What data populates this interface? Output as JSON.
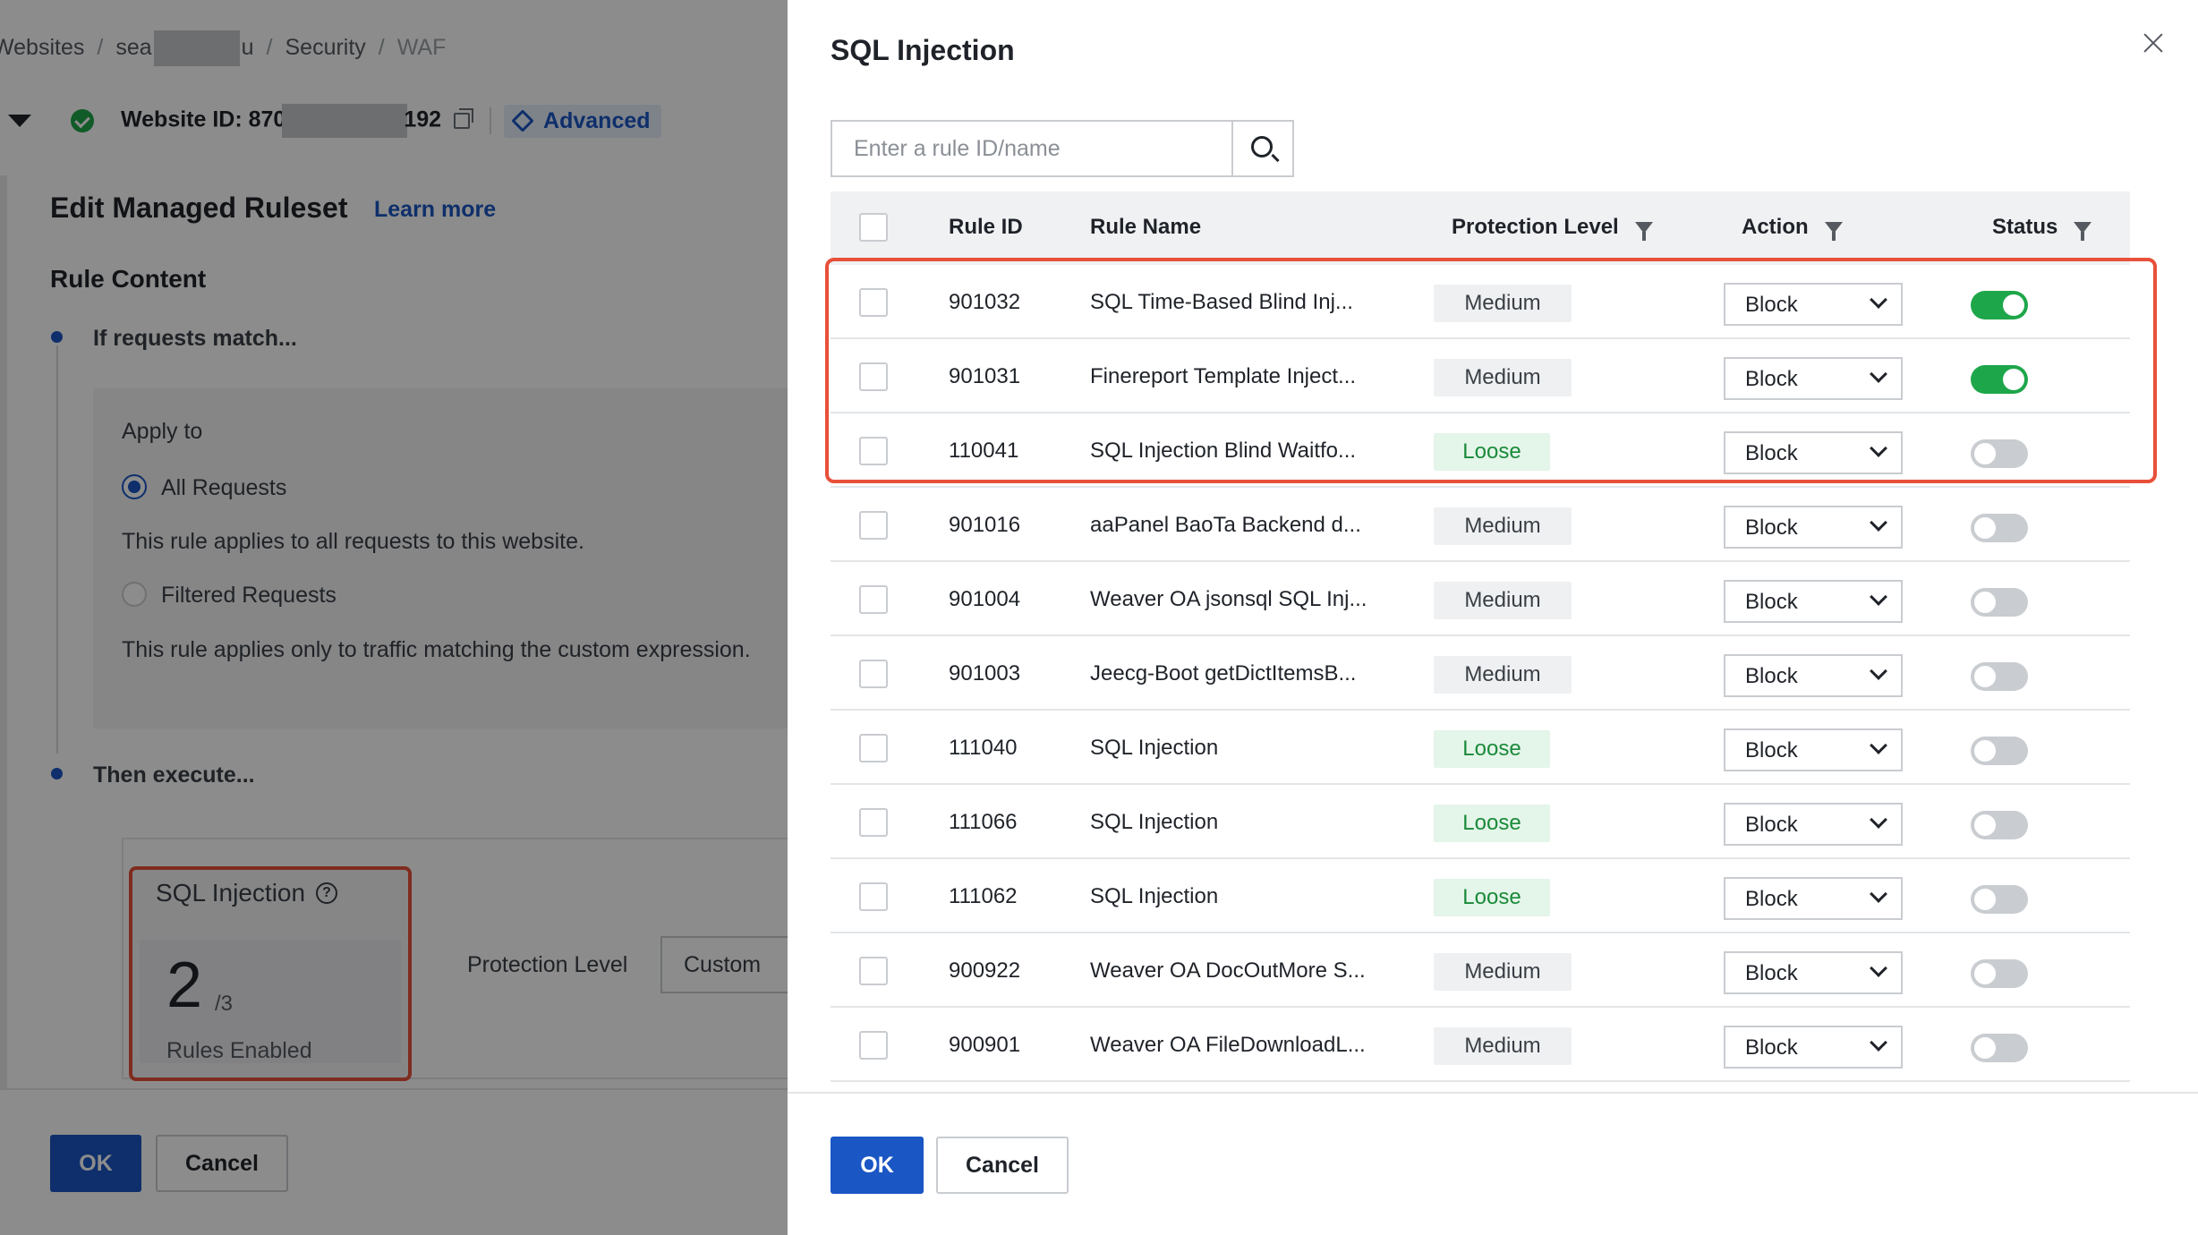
{
  "breadcrumb": {
    "websites": "Websites",
    "site_prefix": "sea",
    "site_suffix": "u",
    "security": "Security",
    "waf": "WAF"
  },
  "website": {
    "id_prefix": "Website ID: 870",
    "id_suffix": "192",
    "advanced_label": "Advanced"
  },
  "editor": {
    "title": "Edit Managed Ruleset",
    "learn_more": "Learn more",
    "rule_content": "Rule Content",
    "if_match": "If requests match...",
    "apply_to": "Apply to",
    "all_requests": "All Requests",
    "all_requests_desc": "This rule applies to all requests to this website.",
    "filtered_requests": "Filtered Requests",
    "filtered_desc": "This rule applies only to traffic matching the custom expression.",
    "then_execute": "Then execute...",
    "card_title": "SQL Injection",
    "enabled_count": "2",
    "total_count": "/3",
    "rules_enabled": "Rules Enabled",
    "protection_level_label": "Protection Level",
    "protection_level_value": "Custom",
    "ok": "OK",
    "cancel": "Cancel"
  },
  "drawer": {
    "title": "SQL Injection",
    "search_placeholder": "Enter a rule ID/name",
    "columns": {
      "rule_id": "Rule ID",
      "rule_name": "Rule Name",
      "protection_level": "Protection Level",
      "action": "Action",
      "status": "Status"
    },
    "rows": [
      {
        "id": "901032",
        "name": "SQL Time-Based Blind Inj...",
        "level": "Medium",
        "action": "Block",
        "enabled": true
      },
      {
        "id": "901031",
        "name": "Finereport Template Inject...",
        "level": "Medium",
        "action": "Block",
        "enabled": true
      },
      {
        "id": "110041",
        "name": "SQL Injection Blind Waitfo...",
        "level": "Loose",
        "action": "Block",
        "enabled": false
      },
      {
        "id": "901016",
        "name": "aaPanel BaoTa Backend d...",
        "level": "Medium",
        "action": "Block",
        "enabled": false
      },
      {
        "id": "901004",
        "name": "Weaver OA jsonsql SQL Inj...",
        "level": "Medium",
        "action": "Block",
        "enabled": false
      },
      {
        "id": "901003",
        "name": "Jeecg-Boot getDictItemsB...",
        "level": "Medium",
        "action": "Block",
        "enabled": false
      },
      {
        "id": "111040",
        "name": "SQL Injection",
        "level": "Loose",
        "action": "Block",
        "enabled": false
      },
      {
        "id": "111066",
        "name": "SQL Injection",
        "level": "Loose",
        "action": "Block",
        "enabled": false
      },
      {
        "id": "111062",
        "name": "SQL Injection",
        "level": "Loose",
        "action": "Block",
        "enabled": false
      },
      {
        "id": "900922",
        "name": "Weaver OA DocOutMore S...",
        "level": "Medium",
        "action": "Block",
        "enabled": false
      },
      {
        "id": "900901",
        "name": "Weaver OA FileDownloadL...",
        "level": "Medium",
        "action": "Block",
        "enabled": false
      }
    ],
    "ok": "OK",
    "cancel": "Cancel"
  },
  "colors": {
    "primary": "#1a56c4",
    "success": "#1ea64a",
    "highlight": "#e8503a"
  }
}
